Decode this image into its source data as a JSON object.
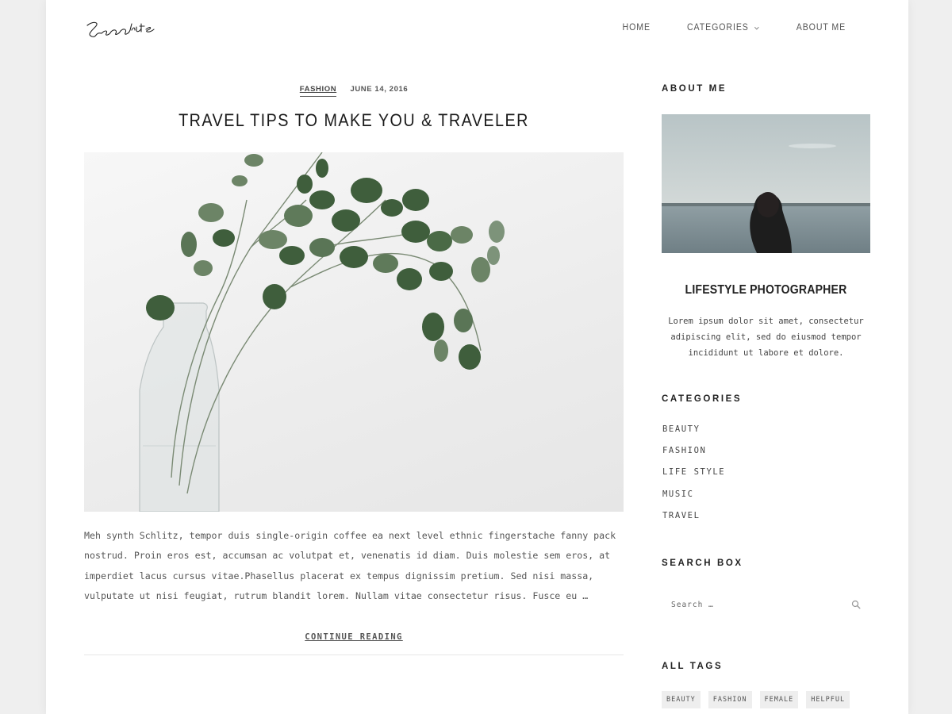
{
  "header": {
    "logo_text": "Sarolite",
    "nav": [
      {
        "label": "HOME"
      },
      {
        "label": "CATEGORIES"
      },
      {
        "label": "ABOUT ME"
      }
    ]
  },
  "post": {
    "category": "FASHION",
    "date": "JUNE 14, 2016",
    "title": "TRAVEL TIPS TO MAKE YOU & TRAVELER",
    "image_alt": "Eucalyptus branches in a glass vase",
    "excerpt": "Meh synth Schlitz, tempor duis single-origin coffee ea next level ethnic fingerstache fanny pack nostrud. Proin eros est, accumsan ac volutpat et, venenatis id diam. Duis molestie sem eros, at imperdiet lacus cursus vitae.Phasellus placerat ex tempus dignissim pretium. Sed nisi massa, vulputate ut nisi feugiat, rutrum blandit lorem. Nullam vitae consectetur risus. Fusce eu …",
    "continue_label": "CONTINUE READING"
  },
  "sidebar": {
    "about": {
      "title": "ABOUT ME",
      "image_alt": "Woman looking at the sea",
      "heading": "LIFESTYLE PHOTOGRAPHER",
      "text": "Lorem ipsum dolor sit amet, consectetur adipiscing elit, sed do eiusmod tempor incididunt ut labore et dolore."
    },
    "categories": {
      "title": "CATEGORIES",
      "items": [
        "BEAUTY",
        "FASHION",
        "LIFE STYLE",
        "MUSIC",
        "TRAVEL"
      ]
    },
    "search": {
      "title": "SEARCH BOX",
      "placeholder": "Search …"
    },
    "tags": {
      "title": "ALL TAGS",
      "items": [
        "BEAUTY",
        "FASHION",
        "FEMALE",
        "HELPFUL"
      ]
    }
  },
  "colors": {
    "page_bg": "#efefef",
    "content_bg": "#ffffff",
    "text": "#333333",
    "tag_bg": "#eeeeee"
  }
}
